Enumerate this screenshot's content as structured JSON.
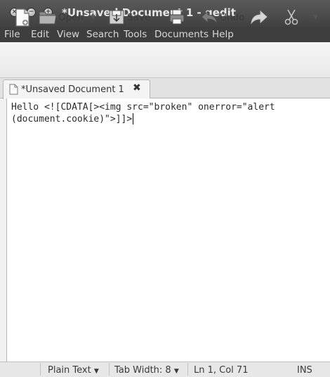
{
  "window": {
    "title": "*Unsaved Document 1 - gedit",
    "controls": {
      "close": "×",
      "minimize": "−",
      "maximize": "+"
    }
  },
  "menu": [
    "File",
    "Edit",
    "View",
    "Search",
    "Tools",
    "Documents",
    "Help"
  ],
  "toolbar": {
    "open_label": "Open",
    "save_label": "Save",
    "undo_label": "Undo",
    "dropdown_arrow": "▼"
  },
  "tab": {
    "label": "*Unsaved Document 1",
    "close_glyph": "✖"
  },
  "editor": {
    "lines": [
      "Hello <![CDATA[><img src=\"broken\" onerror=\"alert",
      "(document.cookie)\">]]>"
    ]
  },
  "statusbar": {
    "language": "Plain Text",
    "tab_width": "Tab Width: 8",
    "position": "Ln 1, Col 71",
    "mode": "INS",
    "arrow": "▼"
  },
  "icons": [
    "close-icon",
    "minimize-icon",
    "maximize-icon",
    "new-document-icon",
    "folder-icon",
    "save-icon",
    "print-icon",
    "undo-icon",
    "redo-icon",
    "cut-icon",
    "document-icon"
  ],
  "colors": {
    "titlebar": "#4a4a46",
    "menubar": "#3e3e3a",
    "toolbar": "#efeeed",
    "editor_bg": "#ffffff",
    "text": "#2a2a2a"
  }
}
